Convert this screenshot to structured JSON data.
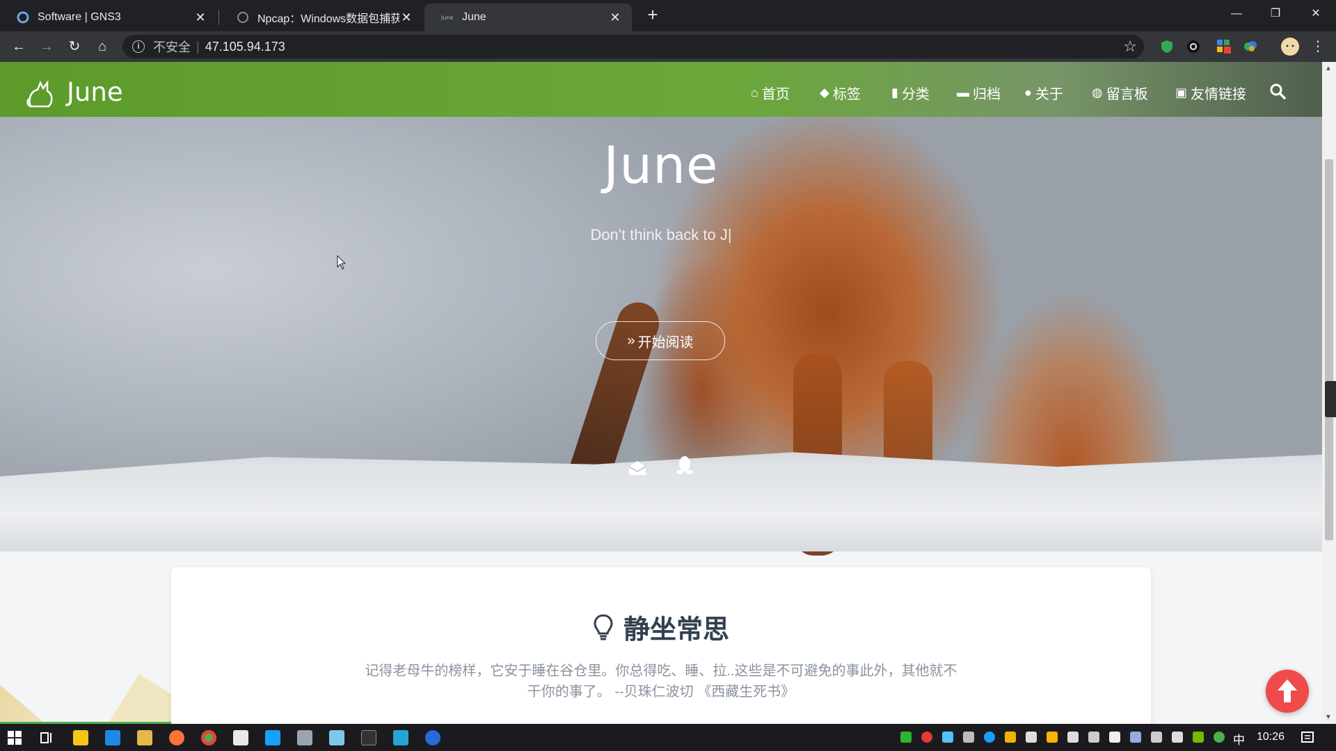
{
  "browser": {
    "tabs": [
      {
        "title": "Software | GNS3",
        "active": false
      },
      {
        "title": "Npcap：Windows数据包捕获库",
        "active": false
      },
      {
        "title": "June",
        "active": true
      }
    ],
    "address": {
      "security_label": "不安全",
      "url": "47.105.94.173"
    }
  },
  "site": {
    "name": "June",
    "nav": [
      {
        "icon": "home-icon",
        "label": "首页"
      },
      {
        "icon": "tags-icon",
        "label": "标签"
      },
      {
        "icon": "bookmark-icon",
        "label": "分类"
      },
      {
        "icon": "archive-icon",
        "label": "归档"
      },
      {
        "icon": "user-circle-icon",
        "label": "关于"
      },
      {
        "icon": "comments-icon",
        "label": "留言板"
      },
      {
        "icon": "address-book-icon",
        "label": "友情链接"
      }
    ],
    "hero": {
      "title": "June",
      "subtitle": "Don't think back to J|",
      "read_button": "开始阅读"
    },
    "quote": {
      "heading": "静坐常思",
      "text": "记得老母牛的榜样，它安于睡在谷仓里。你总得吃、睡、拉..这些是不可避免的事此外，其他就不干你的事了。 --贝珠仁波切 《西藏生死书》"
    }
  },
  "taskbar": {
    "ime": "中",
    "clock": "10:26"
  },
  "colors": {
    "nav_green": "#6aa838",
    "back_top": "#ef4b4b",
    "heading": "#344050"
  }
}
